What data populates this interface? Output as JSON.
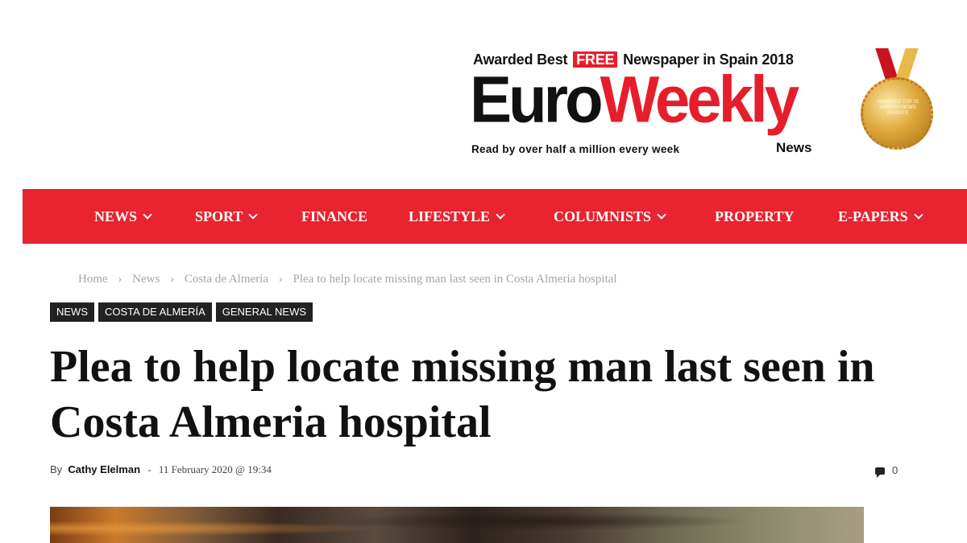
{
  "logo": {
    "tagline_top_before": "Awarded Best",
    "tagline_free": "FREE",
    "tagline_top_after": "Newspaper in Spain 2018",
    "brand_black": "Euro",
    "brand_red": "Weekly",
    "news_label": "News",
    "tagline_bottom": "Read by over half a million every week",
    "medal_text": "AWARDED TOP 15 SPANISH NEWS WEBSITE"
  },
  "nav": {
    "items": [
      {
        "label": "NEWS",
        "has_dropdown": true
      },
      {
        "label": "SPORT",
        "has_dropdown": true
      },
      {
        "label": "FINANCE",
        "has_dropdown": false
      },
      {
        "label": "LIFESTYLE",
        "has_dropdown": true
      },
      {
        "label": "COLUMNISTS",
        "has_dropdown": true
      },
      {
        "label": "PROPERTY",
        "has_dropdown": false
      },
      {
        "label": "E-PAPERS",
        "has_dropdown": true
      }
    ]
  },
  "breadcrumb": {
    "items": [
      "Home",
      "News",
      "Costa de Almería",
      "Plea to help locate missing man last seen in Costa Almeria hospital"
    ],
    "separator": "›"
  },
  "tags": [
    "NEWS",
    "COSTA DE ALMERÍA",
    "GENERAL NEWS"
  ],
  "article": {
    "title": "Plea to help locate missing man last seen in Costa Almeria hospital",
    "by_label": "By",
    "author": "Cathy Elelman",
    "meta_separator": "-",
    "date": "11 February 2020 @ 19:34",
    "comment_count": "0"
  },
  "colors": {
    "brand_red": "#e9232f",
    "tag_bg": "#222222",
    "breadcrumb": "#a6a6a6"
  }
}
